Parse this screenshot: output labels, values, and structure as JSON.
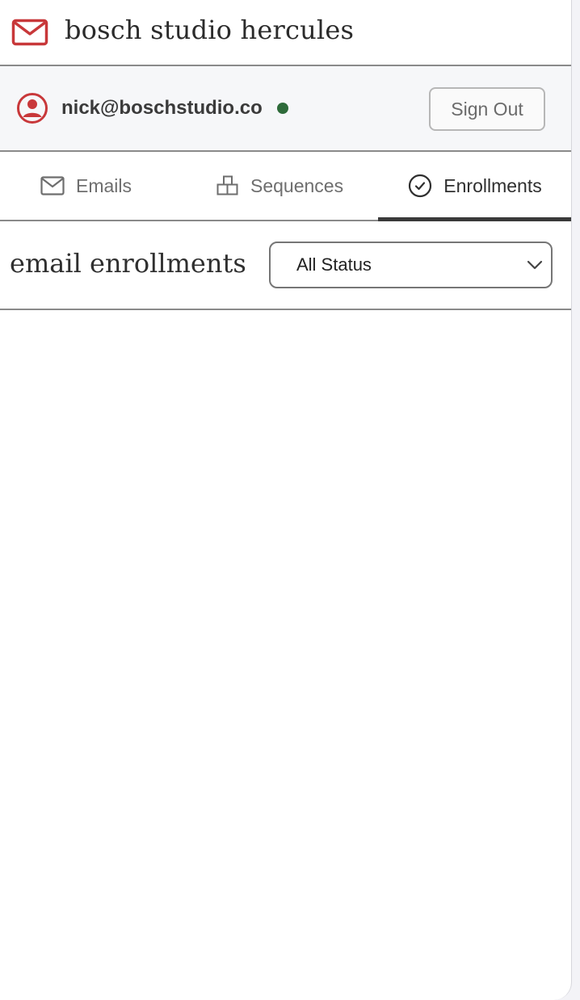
{
  "app": {
    "title": "bosch studio hercules",
    "logo_icon": "mail-icon",
    "accent_color": "#c8383a"
  },
  "user": {
    "email": "nick@boschstudio.co",
    "avatar_icon": "user-circle-icon",
    "status_color": "#2e6b3a",
    "sign_out_label": "Sign Out"
  },
  "tabs": [
    {
      "label": "Emails",
      "icon": "mail-icon",
      "active": false
    },
    {
      "label": "Sequences",
      "icon": "blocks-icon",
      "active": false
    },
    {
      "label": "Enrollments",
      "icon": "check-circle-icon",
      "active": true
    }
  ],
  "enrollments": {
    "title": "email enrollments",
    "status_filter": {
      "selected": "All Status"
    }
  }
}
